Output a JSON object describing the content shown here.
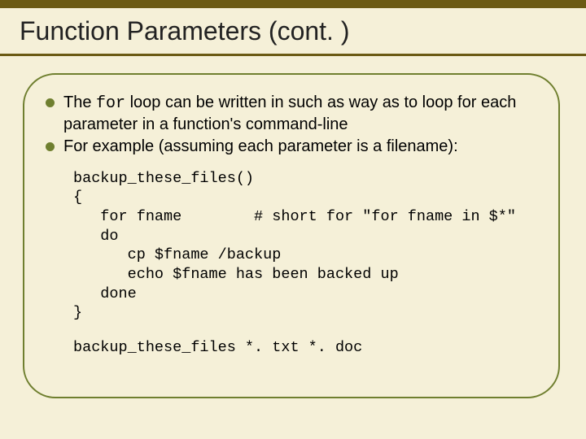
{
  "title": "Function Parameters (cont. )",
  "bullets": [
    {
      "pre": "The ",
      "code": "for",
      "post": " loop can be written in such as way as to loop for each parameter in a function's command-line"
    },
    {
      "pre": "For example (assuming each parameter is a filename):",
      "code": "",
      "post": ""
    }
  ],
  "code": "backup_these_files()\n{\n   for fname        # short for \"for fname in $*\"\n   do\n      cp $fname /backup\n      echo $fname has been backed up\n   done\n}",
  "call": "backup_these_files *. txt *. doc"
}
